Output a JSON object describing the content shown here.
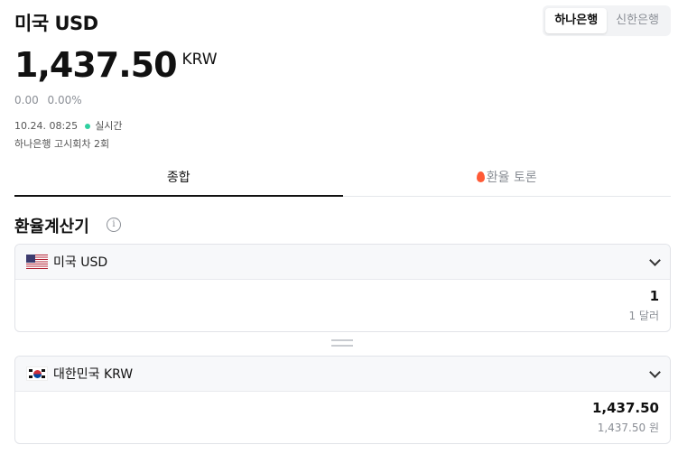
{
  "header": {
    "title": "미국 USD",
    "banks": [
      "하나은행",
      "신한은행"
    ]
  },
  "rate": {
    "value": "1,437.50",
    "unit": "KRW",
    "change": "0.00",
    "change_pct": "0.00%",
    "timestamp": "10.24. 08:25",
    "live_label": "실시간",
    "source": "하나은행 고시회차 2회"
  },
  "tabs": [
    "종합",
    "환율 토론"
  ],
  "calculator": {
    "title": "환율계산기",
    "info_icon": "i",
    "from": {
      "currency": "미국 USD",
      "amount": "1",
      "sub": "1 달러"
    },
    "to": {
      "currency": "대한민국 KRW",
      "amount": "1,437.50",
      "sub": "1,437.50 원"
    }
  },
  "colors": {
    "live_dot": "#2fd0a0",
    "accent_text": "#111111",
    "muted": "#8b8f96"
  }
}
